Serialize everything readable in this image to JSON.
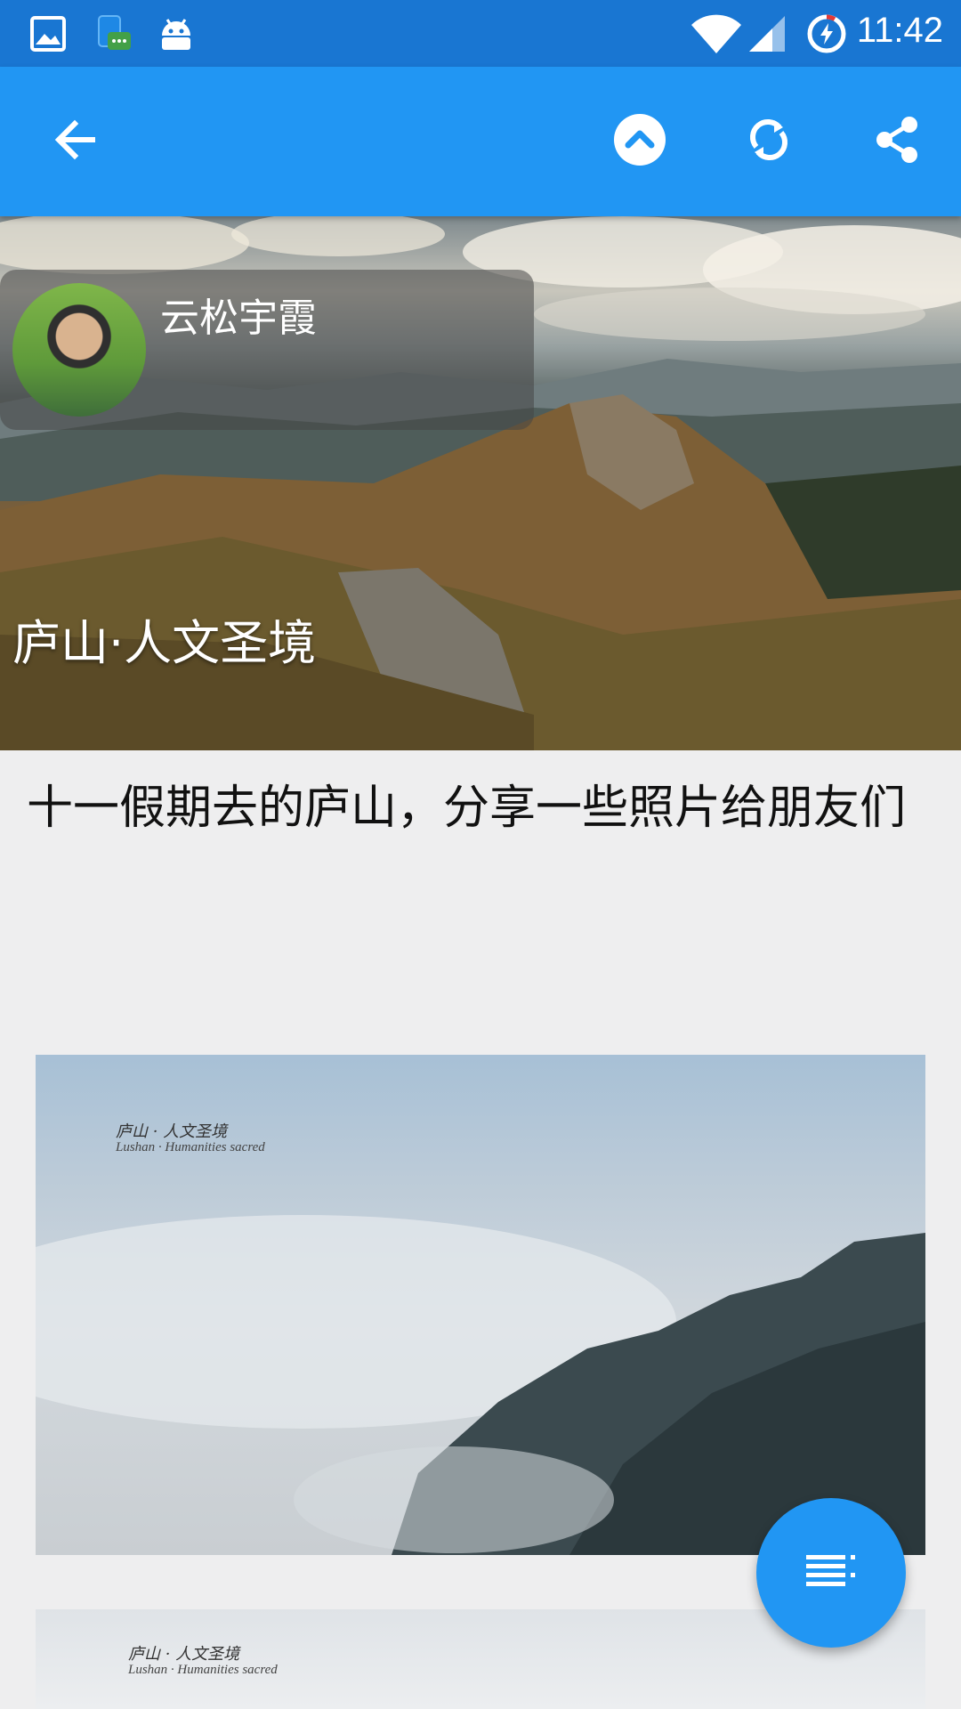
{
  "status_bar": {
    "time": "11:42",
    "icons": [
      "image-icon",
      "messenger-icon",
      "android-icon",
      "wifi-icon",
      "signal-icon",
      "battery-charging-icon"
    ]
  },
  "toolbar": {
    "back_icon": "arrow-left-icon",
    "actions": [
      "scroll-top-icon",
      "refresh-icon",
      "share-icon"
    ]
  },
  "hero": {
    "author_name": "云松宇霞",
    "title": "庐山·人文圣境"
  },
  "post": {
    "title": "十一假期去的庐山，分享一些照片给朋友们"
  },
  "photos": [
    {
      "watermark_cn": "庐山 · 人文圣境",
      "watermark_en": "Lushan · Humanities sacred"
    },
    {
      "watermark_cn": "庐山 · 人文圣境",
      "watermark_en": "Lushan · Humanities sacred"
    }
  ],
  "fab": {
    "icon": "list-menu-icon"
  },
  "colors": {
    "status_bar": "#1976d2",
    "toolbar": "#2196f3",
    "fab": "#2196f3",
    "background": "#eeeeef"
  }
}
